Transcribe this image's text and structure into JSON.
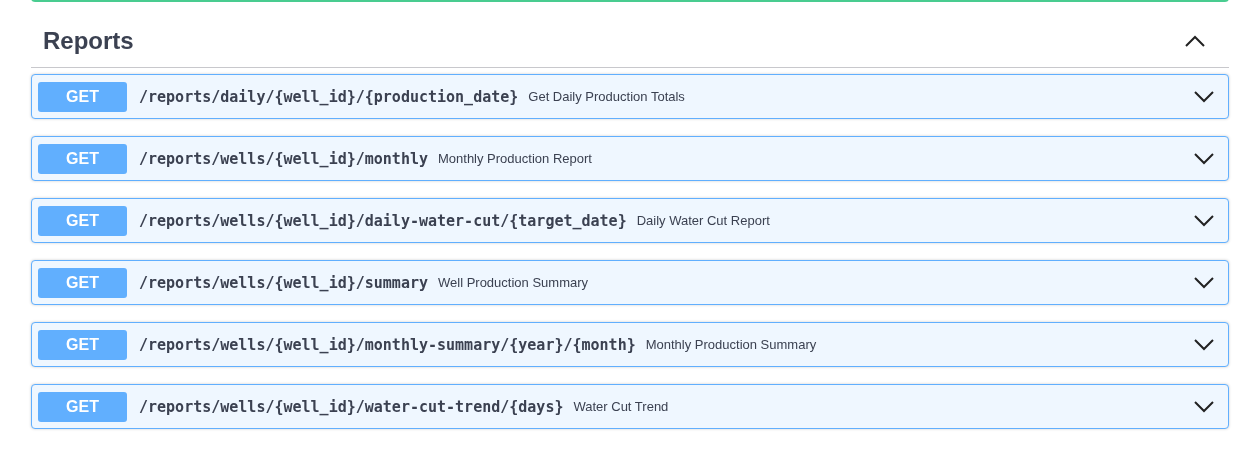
{
  "section": {
    "title": "Reports",
    "expanded": true
  },
  "operations": [
    {
      "method": "GET",
      "path": "/reports/daily/{well_id}/{production_date}",
      "summary": "Get Daily Production Totals",
      "expanded": false
    },
    {
      "method": "GET",
      "path": "/reports/wells/{well_id}/monthly",
      "summary": "Monthly Production Report",
      "expanded": false
    },
    {
      "method": "GET",
      "path": "/reports/wells/{well_id}/daily-water-cut/{target_date}",
      "summary": "Daily Water Cut Report",
      "expanded": false
    },
    {
      "method": "GET",
      "path": "/reports/wells/{well_id}/summary",
      "summary": "Well Production Summary",
      "expanded": false
    },
    {
      "method": "GET",
      "path": "/reports/wells/{well_id}/monthly-summary/{year}/{month}",
      "summary": "Monthly Production Summary",
      "expanded": false
    },
    {
      "method": "GET",
      "path": "/reports/wells/{well_id}/water-cut-trend/{days}",
      "summary": "Water Cut Trend",
      "expanded": false
    }
  ]
}
